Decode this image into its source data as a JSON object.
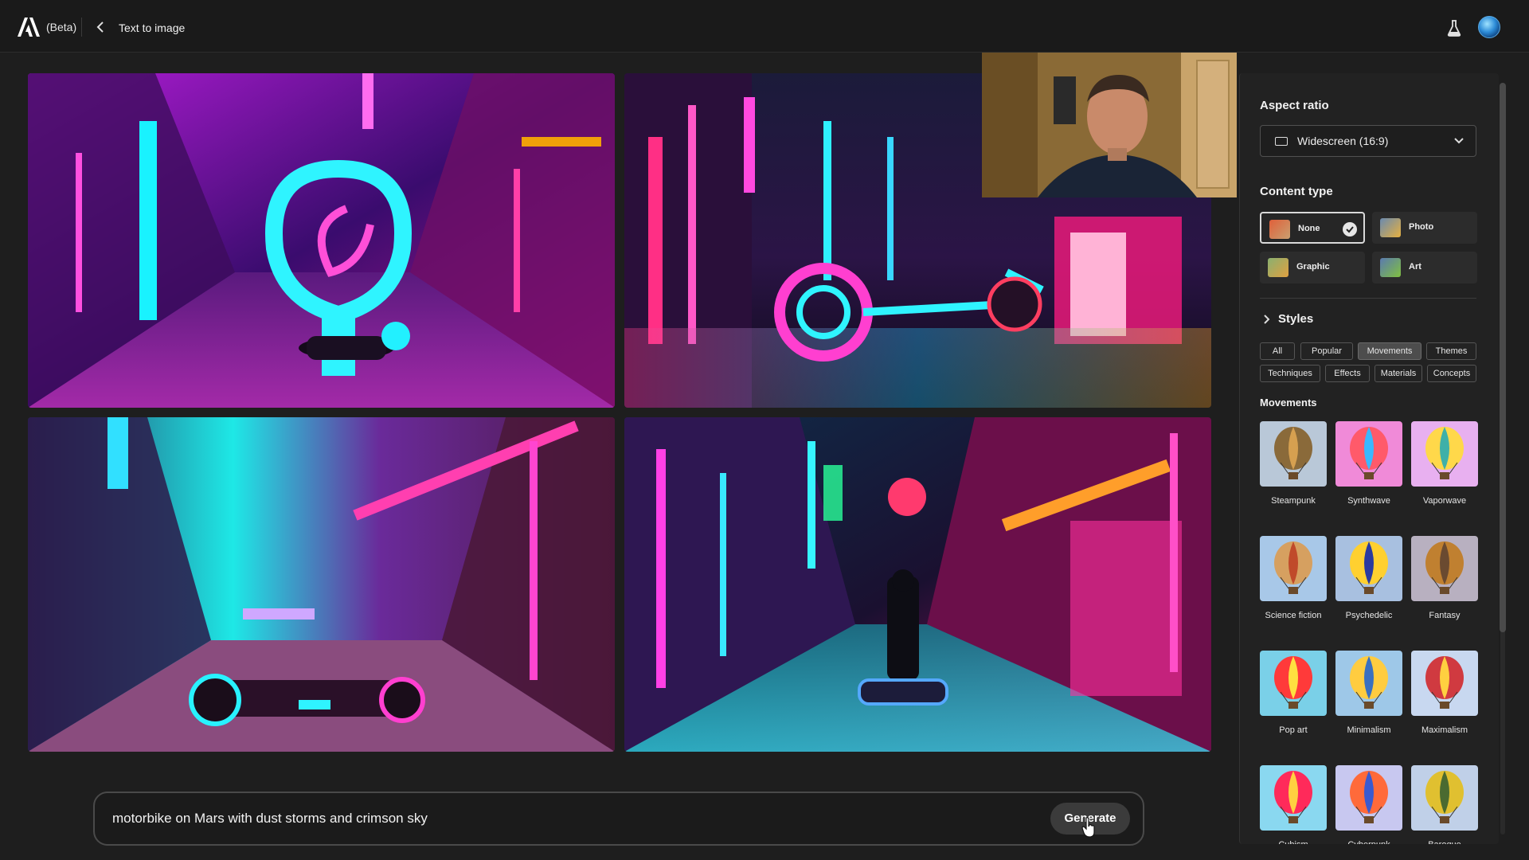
{
  "header": {
    "beta_label": "(Beta)",
    "breadcrumb": "Text to image"
  },
  "panel": {
    "aspect_ratio": {
      "title": "Aspect ratio",
      "selected": "Widescreen (16:9)"
    },
    "content_type": {
      "title": "Content type",
      "options": [
        {
          "label": "None",
          "selected": true
        },
        {
          "label": "Photo",
          "selected": false
        },
        {
          "label": "Graphic",
          "selected": false
        },
        {
          "label": "Art",
          "selected": false
        }
      ]
    },
    "styles": {
      "title": "Styles",
      "tabs": [
        "All",
        "Popular",
        "Movements",
        "Themes",
        "Techniques",
        "Effects",
        "Materials",
        "Concepts"
      ],
      "active_tab": "Movements"
    },
    "movements": {
      "title": "Movements",
      "items": [
        "Steampunk",
        "Synthwave",
        "Vaporwave",
        "Science fiction",
        "Psychedelic",
        "Fantasy",
        "Pop art",
        "Minimalism",
        "Maximalism",
        "Cubism",
        "Cyberpunk",
        "Baroque"
      ]
    }
  },
  "prompt": {
    "text": "motorbike on Mars with dust storms and crimson sky",
    "generate_label": "Generate"
  },
  "colors": {
    "neon_pink": "#ff2fd2",
    "neon_cyan": "#18f0ff",
    "neon_purple": "#8a2be2",
    "bg": "#1e1e1e"
  }
}
